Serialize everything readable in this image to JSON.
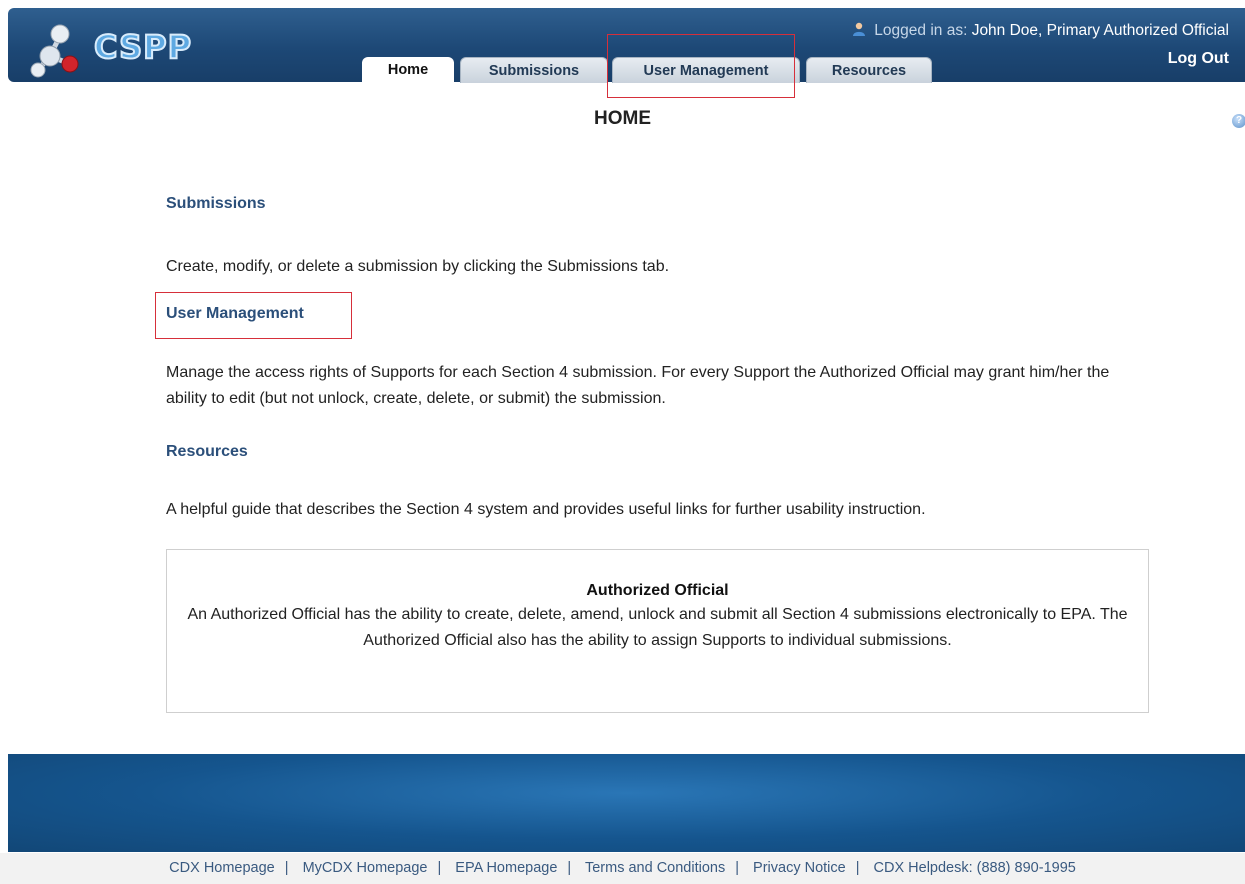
{
  "header": {
    "logo_text": "CSPP",
    "logged_in_label": "Logged in as:",
    "user_name": "John Doe, Primary Authorized Official",
    "logout": "Log Out"
  },
  "tabs": [
    {
      "label": "Home",
      "active": true
    },
    {
      "label": "Submissions",
      "active": false
    },
    {
      "label": "User Management",
      "active": false
    },
    {
      "label": "Resources",
      "active": false
    }
  ],
  "page": {
    "title": "HOME"
  },
  "sections": [
    {
      "title": "Submissions",
      "text": "Create, modify, or delete a submission by clicking the Submissions tab."
    },
    {
      "title": "User Management",
      "text": "Manage the access rights of Supports for each Section 4 submission. For every Support the Authorized Official may grant him/her the ability to edit (but not unlock, create, delete, or submit) the submission."
    },
    {
      "title": "Resources",
      "text": "A helpful guide that describes the Section 4 system and provides useful links for further usability instruction."
    }
  ],
  "info_box": {
    "title": "Authorized Official",
    "text": "An Authorized Official has the ability to create, delete, amend, unlock and submit all Section 4 submissions electronically to EPA. The Authorized Official also has the ability to assign Supports to individual submissions."
  },
  "footer": {
    "links": [
      "CDX Homepage",
      "MyCDX Homepage",
      "EPA Homepage",
      "Terms and Conditions",
      "Privacy Notice",
      "CDX Helpdesk: (888) 890-1995"
    ],
    "separator": "|"
  },
  "colors": {
    "header": "#1d4876",
    "section_title": "#2b4f7a",
    "highlight": "#d62f3a",
    "footer_band": "#15558e"
  },
  "icons": {
    "logo": "molecule-logo-icon",
    "user": "user-icon",
    "help": "help-icon"
  }
}
